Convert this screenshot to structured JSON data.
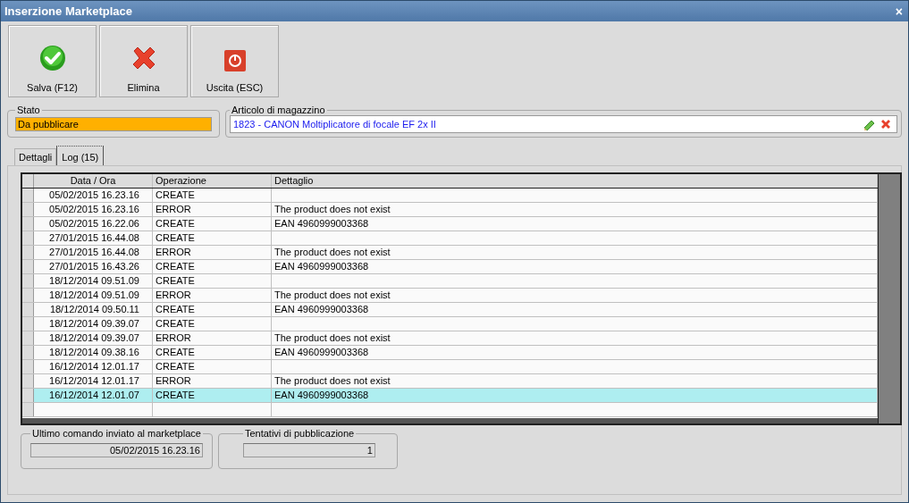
{
  "window": {
    "title": "Inserzione Marketplace",
    "close": "×"
  },
  "toolbar": [
    {
      "label": "Salva (F12)",
      "kind": "save"
    },
    {
      "label": "Elimina",
      "kind": "delete"
    },
    {
      "label": "Uscita (ESC)",
      "kind": "exit"
    }
  ],
  "stato": {
    "legend": "Stato",
    "value": "Da pubblicare",
    "color": "#ffb000"
  },
  "articolo": {
    "legend": "Articolo di magazzino",
    "value": "1823 - CANON Moltiplicatore di focale EF 2x II"
  },
  "tabs": [
    {
      "label": "Dettagli",
      "selected": false
    },
    {
      "label": "Log (15)",
      "selected": true
    }
  ],
  "table": {
    "columns": [
      "Data / Ora",
      "Operazione",
      "Dettaglio"
    ],
    "rows": [
      {
        "cells": [
          "05/02/2015 16.23.16",
          "CREATE",
          ""
        ],
        "selected": false
      },
      {
        "cells": [
          "05/02/2015 16.23.16",
          "ERROR",
          "The product does not exist"
        ],
        "selected": false
      },
      {
        "cells": [
          "05/02/2015 16.22.06",
          "CREATE",
          "EAN 4960999003368"
        ],
        "selected": false
      },
      {
        "cells": [
          "27/01/2015 16.44.08",
          "CREATE",
          ""
        ],
        "selected": false
      },
      {
        "cells": [
          "27/01/2015 16.44.08",
          "ERROR",
          "The product does not exist"
        ],
        "selected": false
      },
      {
        "cells": [
          "27/01/2015 16.43.26",
          "CREATE",
          "EAN 4960999003368"
        ],
        "selected": false
      },
      {
        "cells": [
          "18/12/2014 09.51.09",
          "CREATE",
          ""
        ],
        "selected": false
      },
      {
        "cells": [
          "18/12/2014 09.51.09",
          "ERROR",
          "The product does not exist"
        ],
        "selected": false
      },
      {
        "cells": [
          "18/12/2014 09.50.11",
          "CREATE",
          "EAN 4960999003368"
        ],
        "selected": false
      },
      {
        "cells": [
          "18/12/2014 09.39.07",
          "CREATE",
          ""
        ],
        "selected": false
      },
      {
        "cells": [
          "18/12/2014 09.39.07",
          "ERROR",
          "The product does not exist"
        ],
        "selected": false
      },
      {
        "cells": [
          "18/12/2014 09.38.16",
          "CREATE",
          "EAN 4960999003368"
        ],
        "selected": false
      },
      {
        "cells": [
          "16/12/2014 12.01.17",
          "CREATE",
          ""
        ],
        "selected": false
      },
      {
        "cells": [
          "16/12/2014 12.01.17",
          "ERROR",
          "The product does not exist"
        ],
        "selected": false
      },
      {
        "cells": [
          "16/12/2014 12.01.07",
          "CREATE",
          "EAN 4960999003368"
        ],
        "selected": true
      }
    ]
  },
  "ultimo_comando": {
    "legend": "Ultimo comando inviato al marketplace",
    "value": "05/02/2015 16.23.16"
  },
  "tentativi": {
    "legend": "Tentativi di pubblicazione",
    "value": "1"
  }
}
